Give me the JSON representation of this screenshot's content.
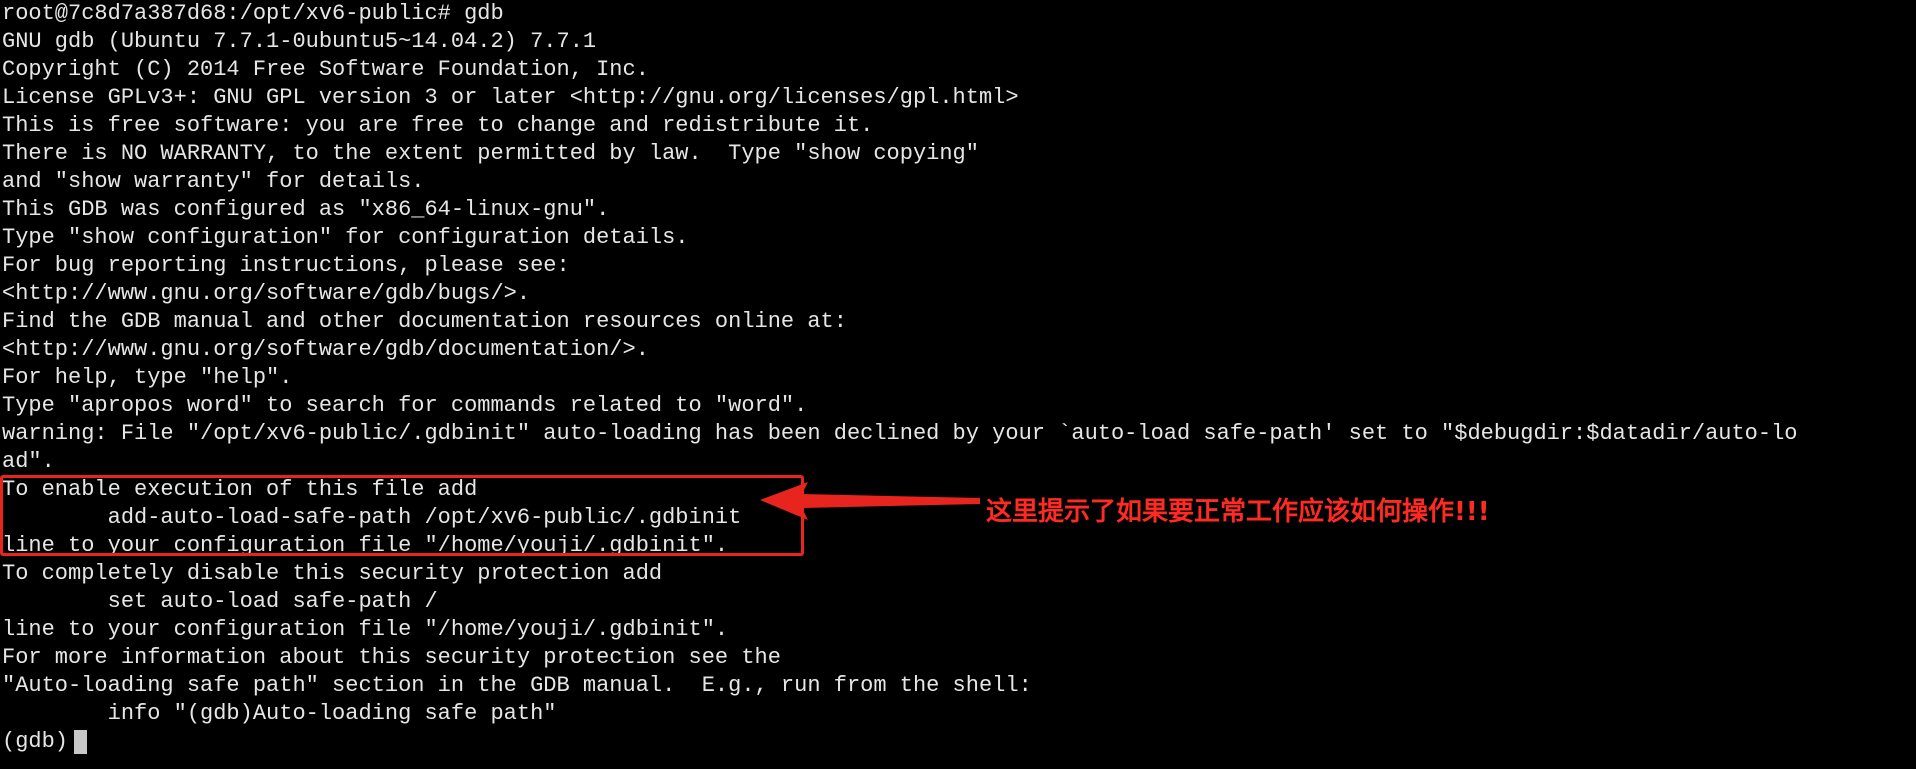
{
  "terminal": {
    "lines": [
      "root@7c8d7a387d68:/opt/xv6-public# gdb",
      "GNU gdb (Ubuntu 7.7.1-0ubuntu5~14.04.2) 7.7.1",
      "Copyright (C) 2014 Free Software Foundation, Inc.",
      "License GPLv3+: GNU GPL version 3 or later <http://gnu.org/licenses/gpl.html>",
      "This is free software: you are free to change and redistribute it.",
      "There is NO WARRANTY, to the extent permitted by law.  Type \"show copying\"",
      "and \"show warranty\" for details.",
      "This GDB was configured as \"x86_64-linux-gnu\".",
      "Type \"show configuration\" for configuration details.",
      "For bug reporting instructions, please see:",
      "<http://www.gnu.org/software/gdb/bugs/>.",
      "Find the GDB manual and other documentation resources online at:",
      "<http://www.gnu.org/software/gdb/documentation/>.",
      "For help, type \"help\".",
      "Type \"apropos word\" to search for commands related to \"word\".",
      "warning: File \"/opt/xv6-public/.gdbinit\" auto-loading has been declined by your `auto-load safe-path' set to \"$debugdir:$datadir/auto-lo",
      "ad\".",
      "To enable execution of this file add",
      "        add-auto-load-safe-path /opt/xv6-public/.gdbinit",
      "line to your configuration file \"/home/youji/.gdbinit\".",
      "To completely disable this security protection add",
      "        set auto-load safe-path /",
      "line to your configuration file \"/home/youji/.gdbinit\".",
      "For more information about this security protection see the",
      "\"Auto-loading safe path\" section in the GDB manual.  E.g., run from the shell:",
      "        info \"(gdb)Auto-loading safe path\""
    ],
    "prompt": "(gdb)"
  },
  "annotation": {
    "text": "这里提示了如果要正常工作应该如何操作!!!",
    "color": "#ff2a23"
  },
  "colors": {
    "background": "#000000",
    "foreground": "#e6e6e6",
    "highlight": "#e8241f"
  }
}
